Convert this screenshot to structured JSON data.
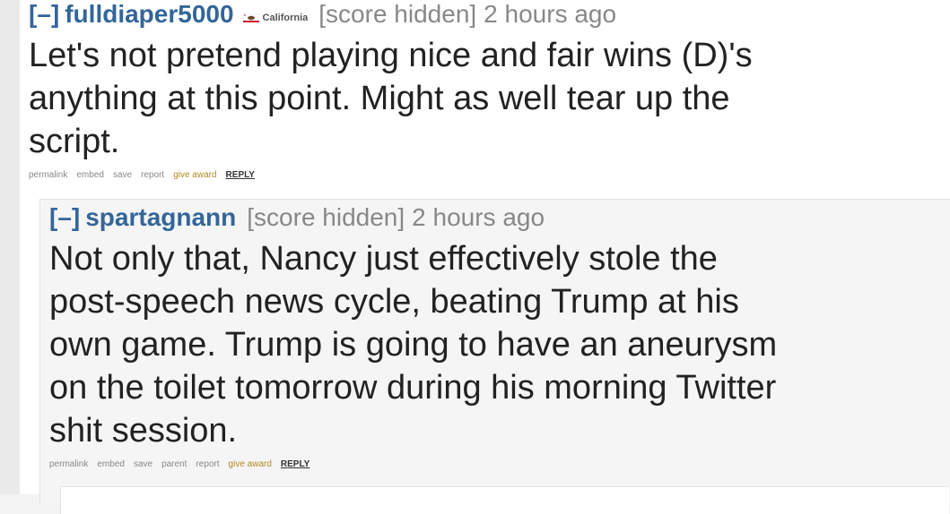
{
  "comments": [
    {
      "expand": "[–]",
      "author": "fulldiaper5000",
      "flair_text": "California",
      "flair_icon": "california-flag-icon",
      "score": "[score hidden]",
      "time": "2 hours ago",
      "body_lines": [
        "Let's not pretend playing nice and fair wins (D)'s",
        "anything at this point. Might as well tear up the",
        "script."
      ],
      "buttons": {
        "permalink": "permalink",
        "embed": "embed",
        "save": "save",
        "report": "report",
        "give_award": "give award",
        "reply": "REPLY"
      }
    },
    {
      "expand": "[–]",
      "author": "spartagnann",
      "score": "[score hidden]",
      "time": "2 hours ago",
      "body_lines": [
        "Not only that, Nancy just effectively stole the",
        "post-speech news cycle, beating Trump at his",
        "own game. Trump is going to have an aneurysm",
        "on the toilet tomorrow during his morning Twitter",
        "shit session."
      ],
      "buttons": {
        "permalink": "permalink",
        "embed": "embed",
        "save": "save",
        "parent": "parent",
        "report": "report",
        "give_award": "give award",
        "reply": "REPLY"
      }
    }
  ],
  "colors": {
    "author": "#336699",
    "meta": "#888888",
    "award": "#b08a1e"
  }
}
